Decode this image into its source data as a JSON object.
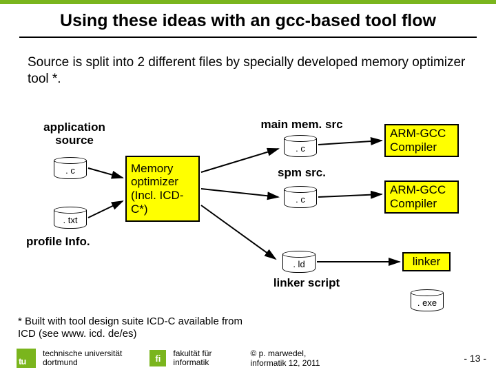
{
  "title": "Using these ideas with an gcc-based tool flow",
  "intro": "Source is split into 2 different files by specially developed memory optimizer tool *.",
  "labels": {
    "app_source": "application\nsource",
    "main_mem": "main mem. src",
    "spm": "spm src.",
    "profile": "profile Info.",
    "linker_script": "linker script"
  },
  "boxes": {
    "mem_opt": "Memory\noptimizer\n(Incl. ICD-\nC*)",
    "arm_gcc": "ARM-GCC\nCompiler",
    "linker": "linker"
  },
  "files": {
    "src_c": ". c",
    "src_txt": ". txt",
    "main_c": ". c",
    "spm_c": ". c",
    "ld": ". ld",
    "exe": ". exe"
  },
  "footnote": "* Built with tool design suite ICD-C available from ICD (see www. icd. de/es)",
  "footer": {
    "tu": "tu",
    "uni1": "technische universität",
    "uni2": "dortmund",
    "fi": "fi",
    "fac1": "fakultät für",
    "fac2": "informatik",
    "cred1_sym": "©",
    "cred1": " p. marwedel,",
    "cred2": "informatik 12,  2011",
    "page": "-  13 -"
  }
}
